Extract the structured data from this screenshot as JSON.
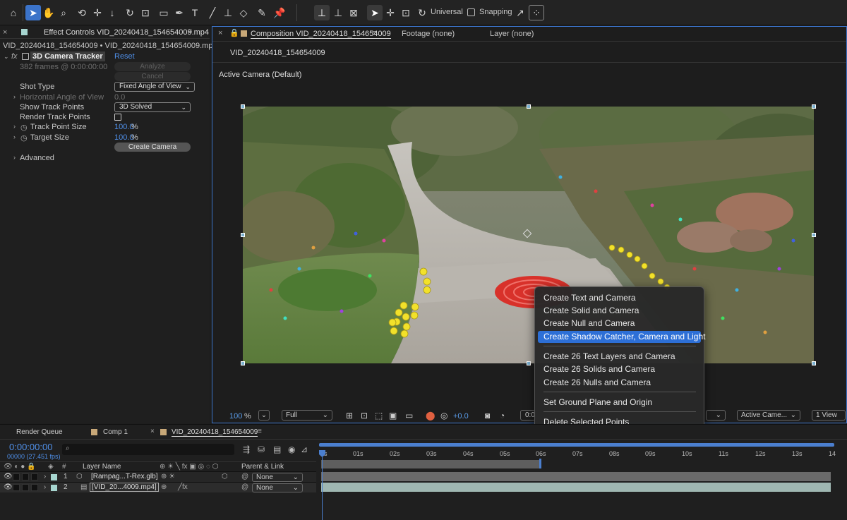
{
  "toolbar": {
    "universal_label": "Universal",
    "snapping_label": "Snapping"
  },
  "effect_controls": {
    "tab_title": "Effect Controls VID_20240418_154654009.mp4",
    "breadcrumb": "VID_20240418_154654009 • VID_20240418_154654009.mp4",
    "effect_name": "3D Camera Tracker",
    "reset_label": "Reset",
    "frames_info": "382 frames @ 0:00:00:00",
    "analyze_label": "Analyze",
    "cancel_label": "Cancel",
    "shot_type_label": "Shot Type",
    "shot_type_value": "Fixed Angle of View",
    "hav_label": "Horizontal Angle of View",
    "hav_value": "0.0",
    "show_track_points_label": "Show Track Points",
    "show_track_points_value": "3D Solved",
    "render_track_points_label": "Render Track Points",
    "track_point_size_label": "Track Point Size",
    "track_point_size_value": "100.0",
    "target_size_label": "Target Size",
    "target_size_value": "100.0",
    "percent": "%",
    "create_camera_label": "Create Camera",
    "advanced_label": "Advanced"
  },
  "composition": {
    "tab_title": "Composition VID_20240418_154654009",
    "footage_tab": "Footage (none)",
    "layer_tab": "Layer (none)",
    "comp_name": "VID_20240418_154654009",
    "camera_label": "Active Camera (Default)",
    "zoom_value": "100",
    "zoom_unit": "%",
    "resolution": "Full",
    "exposure": "+0.0",
    "timecode_partial": "0:0",
    "view_camera": "Active Came...",
    "view_count": "1 View"
  },
  "context_menu": {
    "items": [
      "Create Text and Camera",
      "Create Solid and Camera",
      "Create Null and Camera",
      "Create Shadow Catcher, Camera and Light",
      "Create 26 Text Layers and Camera",
      "Create 26 Solids and Camera",
      "Create 26 Nulls and Camera",
      "Set Ground Plane and Origin",
      "Delete Selected Points"
    ],
    "highlighted_index": 3
  },
  "timeline": {
    "tabs": [
      "Render Queue",
      "Comp 1",
      "VID_20240418_154654009"
    ],
    "timecode": "0:00:00:00",
    "fps_info": "00000 (27.451 fps)",
    "ruler": [
      "0s",
      "01s",
      "02s",
      "03s",
      "04s",
      "05s",
      "06s",
      "07s",
      "08s",
      "09s",
      "10s",
      "11s",
      "12s",
      "13s",
      "14"
    ],
    "col_hash": "#",
    "col_layer_name": "Layer Name",
    "col_parent": "Parent & Link",
    "layers": [
      {
        "num": "1",
        "name": "[Rampag...T-Rex.glb]",
        "parent": "None"
      },
      {
        "num": "2",
        "name": "[VID_20...4009.mp4]",
        "parent": "None"
      }
    ]
  },
  "colors": {
    "accent": "#3b73c9",
    "menu_highlight": "#2d6fd6",
    "layer1_label": "#a7d6d0",
    "layer2_label": "#a7d6d0",
    "track_point_yellow": "#f2e12a",
    "target_red": "#d8312a"
  }
}
